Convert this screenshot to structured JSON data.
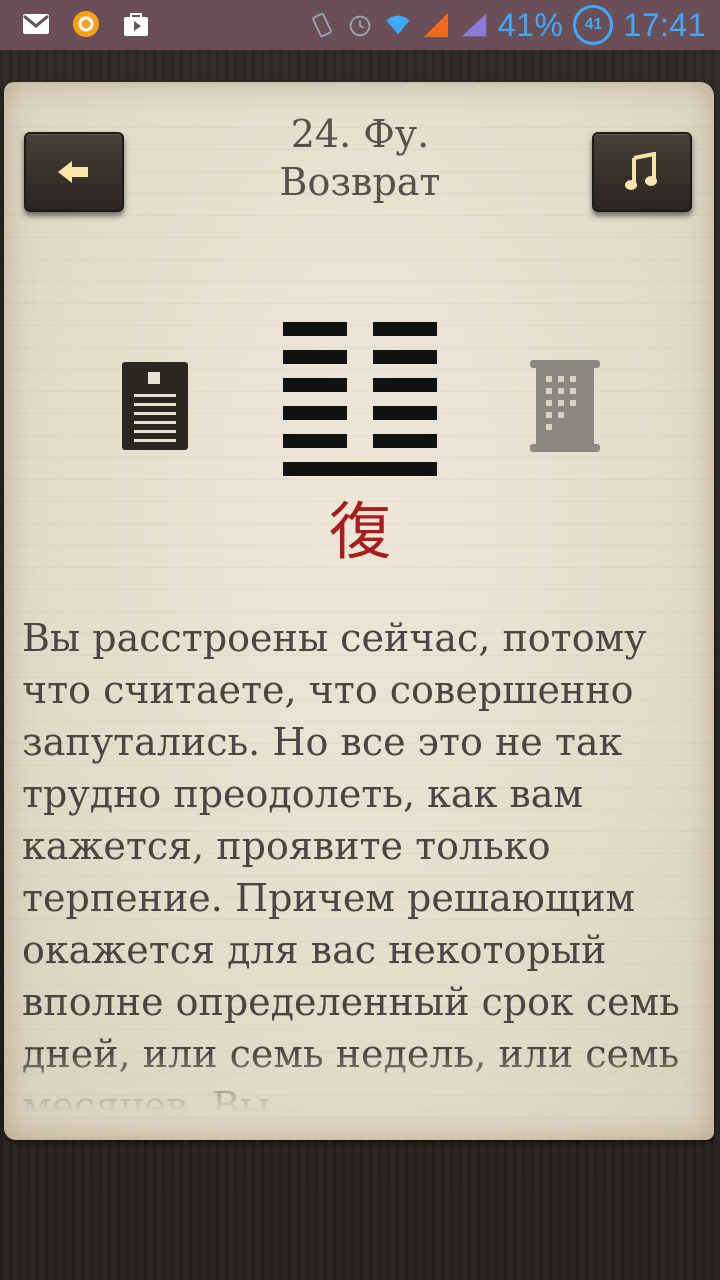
{
  "status_bar": {
    "battery_percent": "41%",
    "battery_ring": "41",
    "time": "17:41",
    "icons": [
      "gmail-icon",
      "notification-app-icon",
      "play-store-icon",
      "rotate-icon",
      "alarm-icon",
      "wifi-icon",
      "signal-icon",
      "signal-icon-2"
    ]
  },
  "header": {
    "number_title": "24. Фу.",
    "subtitle": "Возврат",
    "back_icon": "arrow-left-icon",
    "music_icon": "music-note-icon"
  },
  "hexagram": {
    "lines_top_to_bottom": [
      "broken",
      "broken",
      "broken",
      "broken",
      "broken",
      "solid"
    ],
    "hanzi": "復"
  },
  "body": {
    "text": "Вы расстроены сейчас, потому что считаете, что совершенно запутались. Но все это не так трудно преодолеть, как вам кажется, проявите только терпение. Причем решающим окажется для вас некоторый вполне определенный срок  семь дней, или семь недель, или семь месяцев. Вы"
  },
  "colors": {
    "status_bar_bg": "#6b4f56",
    "status_accent": "#3fa9ff",
    "hanzi_red": "#a51d1d",
    "text": "#4a4540"
  }
}
